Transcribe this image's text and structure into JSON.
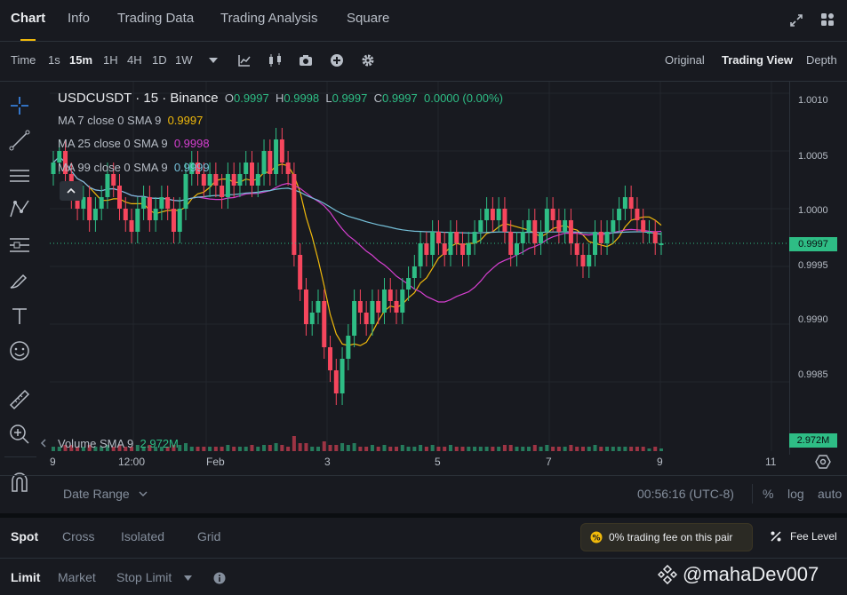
{
  "tabs": [
    {
      "label": "Chart",
      "active": true
    },
    {
      "label": "Info"
    },
    {
      "label": "Trading Data"
    },
    {
      "label": "Trading Analysis"
    },
    {
      "label": "Square"
    }
  ],
  "toolbar": {
    "intervals": [
      "Time",
      "1s",
      "15m",
      "1H",
      "4H",
      "1D",
      "1W"
    ],
    "active_interval": "15m",
    "views": [
      "Original",
      "Trading View",
      "Depth"
    ],
    "active_view": "Trading View"
  },
  "legend": {
    "symbol": "USDCUSDT · 15 · Binance",
    "o_label": "O",
    "o": "0.9997",
    "h_label": "H",
    "h": "0.9998",
    "l_label": "L",
    "l": "0.9997",
    "c_label": "C",
    "c": "0.9997",
    "change": "0.0000 (0.00%)",
    "ma7_label": "MA 7 close 0 SMA 9",
    "ma7": "0.9997",
    "ma25_label": "MA 25 close 0 SMA 9",
    "ma25": "0.9998",
    "ma99_label": "MA 99 close 0 SMA 9",
    "ma99": "0.9999",
    "volume_label": "Volume SMA 9",
    "volume": "2.972M"
  },
  "y_axis": [
    "1.0010",
    "1.0005",
    "1.0000",
    "0.9995",
    "0.9990",
    "0.9985"
  ],
  "x_axis": [
    "9",
    "12:00",
    "Feb",
    "3",
    "5",
    "7",
    "9",
    "11"
  ],
  "last_price": "0.9997",
  "volume_tag": "2.972M",
  "footer": {
    "date_range": "Date Range",
    "time": "00:56:16 (UTC-8)",
    "pct": "%",
    "log": "log",
    "auto": "auto"
  },
  "trade_tabs": [
    "Spot",
    "Cross",
    "Isolated",
    "Grid"
  ],
  "fee_banner": "0% trading fee on this pair",
  "fee_level": "Fee Level",
  "order_tabs": [
    "Limit",
    "Market",
    "Stop Limit"
  ],
  "watermark": "@mahaDev007",
  "colors": {
    "up": "#2ebd85",
    "down": "#f6465d",
    "ma7": "#f0b90b",
    "ma25": "#d63fd0",
    "ma99": "#76c1da",
    "accent": "#f0b90b"
  },
  "chart_data": {
    "type": "candlestick",
    "pair": "USDCUSDT",
    "interval": "15m",
    "ylim": [
      0.9981,
      1.0011
    ],
    "x_ticks": [
      "9",
      "12:00",
      "Feb",
      "3",
      "5",
      "7",
      "9",
      "11"
    ],
    "closes": [
      1.0004,
      1.0005,
      1.0003,
      1.0001,
      1.0,
      1.0001,
      0.9999,
      1.0,
      1.0001,
      1.0003,
      1.0002,
      1.0,
      0.9999,
      0.9998,
      1.0,
      1.0001,
      0.9999,
      1.0,
      1.0001,
      1.0,
      0.9998,
      1.0,
      1.0003,
      1.0004,
      1.0003,
      1.0002,
      1.0003,
      1.0002,
      1.0001,
      1.0003,
      1.0002,
      1.0003,
      1.0004,
      1.0002,
      1.0003,
      1.0005,
      1.0003,
      1.0006,
      1.0004,
      1.0003,
      0.9996,
      0.9993,
      0.999,
      0.9991,
      0.9992,
      0.9988,
      0.9986,
      0.9984,
      0.9987,
      0.9989,
      0.9992,
      0.9991,
      0.999,
      0.9992,
      0.9991,
      0.9993,
      0.9992,
      0.9991,
      0.9993,
      0.9994,
      0.9995,
      0.9997,
      0.9996,
      0.9998,
      0.9997,
      0.9996,
      0.9998,
      0.9997,
      0.9996,
      0.9997,
      0.9998,
      0.9999,
      1.0,
      0.9999,
      1.0,
      0.9998,
      0.9996,
      0.9997,
      0.9998,
      0.9999,
      0.9997,
      0.9998,
      1.0,
      0.9999,
      0.9998,
      0.9999,
      0.9997,
      0.9996,
      0.9995,
      0.9996,
      0.9998,
      0.9997,
      0.9998,
      0.9999,
      1.0,
      1.0001,
      1.0,
      0.9999,
      0.9998,
      0.9998,
      0.9997,
      0.9997
    ],
    "series": [
      {
        "name": "MA 7",
        "period": 7
      },
      {
        "name": "MA 25",
        "period": 25
      },
      {
        "name": "MA 99",
        "period": 99
      }
    ]
  }
}
